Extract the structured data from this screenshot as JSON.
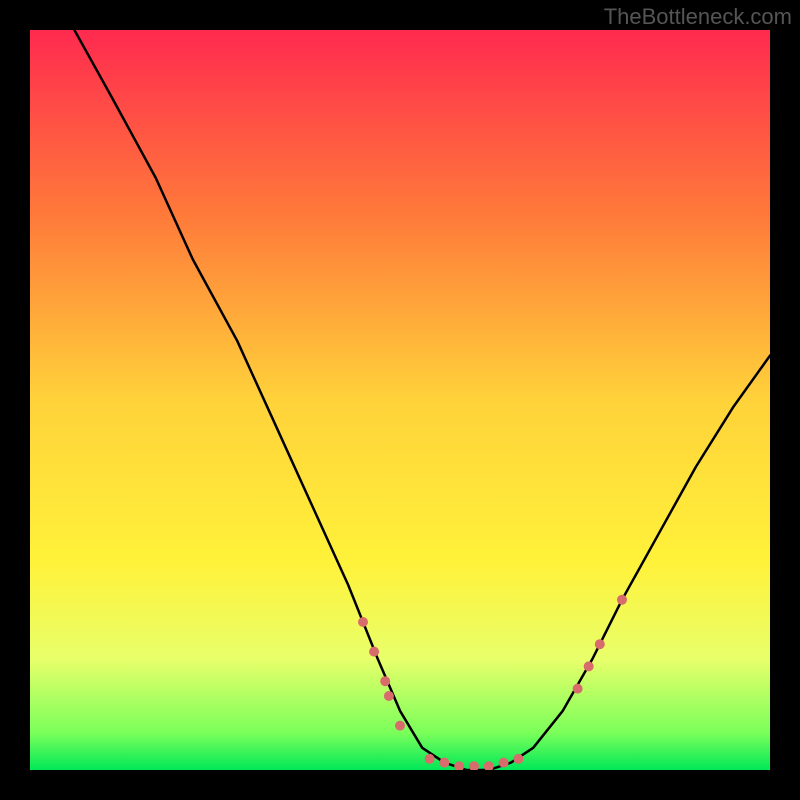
{
  "watermark": "TheBottleneck.com",
  "chart_data": {
    "type": "line",
    "title": "",
    "xlabel": "",
    "ylabel": "",
    "xlim": [
      0,
      100
    ],
    "ylim": [
      0,
      100
    ],
    "gradient_background": {
      "type": "vertical",
      "stops": [
        {
          "offset": 0,
          "color": "#ff2a4f"
        },
        {
          "offset": 25,
          "color": "#ff7a3a"
        },
        {
          "offset": 50,
          "color": "#ffd23a"
        },
        {
          "offset": 72,
          "color": "#fff23a"
        },
        {
          "offset": 85,
          "color": "#e8ff6a"
        },
        {
          "offset": 95,
          "color": "#7aff5a"
        },
        {
          "offset": 100,
          "color": "#00e858"
        }
      ]
    },
    "series": [
      {
        "name": "bottleneck-curve",
        "type": "line",
        "color": "#000000",
        "x": [
          6,
          11,
          17,
          22,
          28,
          33,
          38,
          43,
          47,
          50,
          53,
          56,
          59,
          62,
          65,
          68,
          72,
          76,
          80,
          85,
          90,
          95,
          100
        ],
        "y": [
          100,
          91,
          80,
          69,
          58,
          47,
          36,
          25,
          15,
          8,
          3,
          1,
          0,
          0,
          1,
          3,
          8,
          15,
          23,
          32,
          41,
          49,
          56
        ]
      }
    ],
    "scatter_points": {
      "name": "highlighted-points",
      "color": "#d86b6b",
      "radius": 5,
      "points": [
        {
          "x": 45,
          "y": 20
        },
        {
          "x": 46.5,
          "y": 16
        },
        {
          "x": 48,
          "y": 12
        },
        {
          "x": 48.5,
          "y": 10
        },
        {
          "x": 50,
          "y": 6
        },
        {
          "x": 54,
          "y": 1.5
        },
        {
          "x": 56,
          "y": 1
        },
        {
          "x": 58,
          "y": 0.5
        },
        {
          "x": 60,
          "y": 0.5
        },
        {
          "x": 62,
          "y": 0.5
        },
        {
          "x": 64,
          "y": 1
        },
        {
          "x": 66,
          "y": 1.5
        },
        {
          "x": 74,
          "y": 11
        },
        {
          "x": 75.5,
          "y": 14
        },
        {
          "x": 77,
          "y": 17
        },
        {
          "x": 80,
          "y": 23
        }
      ]
    }
  }
}
